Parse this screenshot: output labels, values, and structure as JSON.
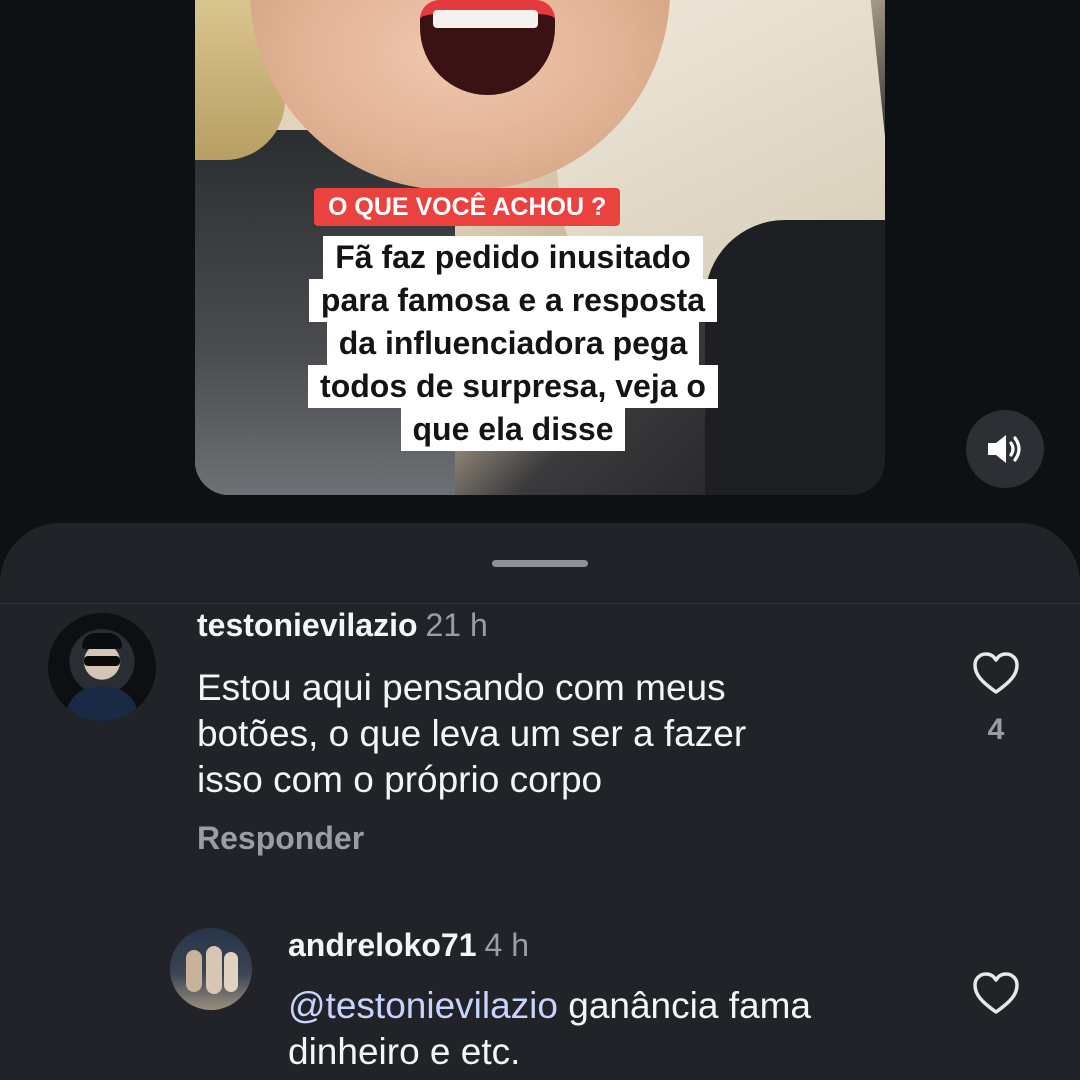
{
  "video": {
    "tag_label": "O QUE VOCÊ ACHOU ?",
    "headline_lines": [
      "Fã faz pedido inusitado",
      "para famosa e a resposta",
      "da influenciadora pega",
      "todos de surpresa, veja o",
      "que ela disse"
    ],
    "sound_icon": "speaker-on-icon"
  },
  "comments": [
    {
      "username": "testonievilazio",
      "time": "21 h",
      "text_lines": [
        "Estou aqui pensando com meus",
        "botões, o que leva um ser a fazer",
        "isso com o próprio corpo"
      ],
      "likes": "4",
      "reply_label": "Responder"
    },
    {
      "username": "andreloko71",
      "time": "4 h",
      "mention": "@testonievilazio",
      "text_rest": " ganância fama",
      "text_line2": "dinheiro e etc."
    }
  ],
  "colors": {
    "background": "#0e1114",
    "sheet": "#212328",
    "tag_red": "#e9423f",
    "muted_text": "#9a9ea4"
  }
}
